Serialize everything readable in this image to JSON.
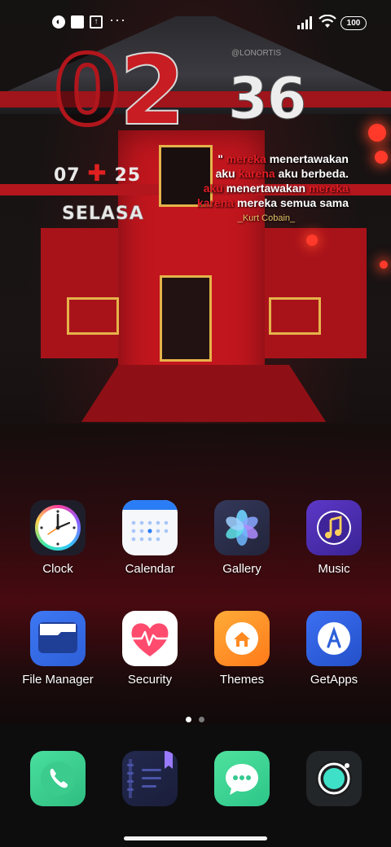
{
  "status_bar": {
    "more": "···",
    "battery": "100"
  },
  "clock_widget": {
    "hour_d1": "0",
    "hour_d2": "2",
    "minute": "36",
    "watermark": "@LONORTIS",
    "date_day": "07",
    "date_month": "25",
    "day_name": "SELASA"
  },
  "quote": {
    "open_mark": "\"",
    "l1_red": "mereka",
    "l1": " menertawakan",
    "l2a": "aku ",
    "l2_red": "karena",
    "l2b": " aku berbeda.",
    "l3_red1": "aku",
    "l3": " menertawakan ",
    "l3_red2": "mereka",
    "l4_red": "karena",
    "l4": " mereka semua sama",
    "author": "_Kurt Cobain_"
  },
  "apps": [
    {
      "label": "Clock",
      "icon": "clock-icon"
    },
    {
      "label": "Calendar",
      "icon": "calendar-icon"
    },
    {
      "label": "Gallery",
      "icon": "gallery-icon"
    },
    {
      "label": "Music",
      "icon": "music-icon"
    },
    {
      "label": "File Manager",
      "icon": "folder-icon"
    },
    {
      "label": "Security",
      "icon": "heart-pulse-icon"
    },
    {
      "label": "Themes",
      "icon": "home-icon"
    },
    {
      "label": "GetApps",
      "icon": "app-store-icon"
    }
  ],
  "dock": [
    {
      "icon": "phone-icon"
    },
    {
      "icon": "notes-icon"
    },
    {
      "icon": "message-icon"
    },
    {
      "icon": "camera-icon"
    }
  ],
  "page_indicator": {
    "pages": 2,
    "current": 1
  },
  "colors": {
    "accent_red": "#e11d24",
    "lantern": "#ff3a2a"
  }
}
